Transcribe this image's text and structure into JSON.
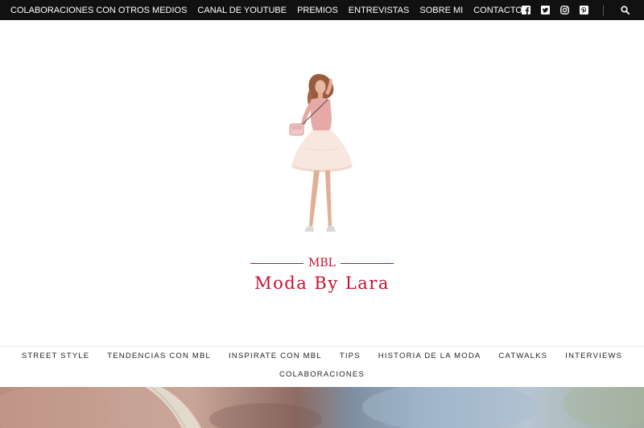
{
  "topbar": {
    "links": [
      "COLABORACIONES CON OTROS MEDIOS",
      "CANAL DE YOUTUBE",
      "PREMIOS",
      "ENTREVISTAS",
      "SOBRE MI",
      "CONTACTO"
    ],
    "social_icons": [
      "facebook-icon",
      "twitter-icon",
      "instagram-icon",
      "pinterest-icon"
    ],
    "search_icon": "search-icon"
  },
  "logo": {
    "mbl": "MBL",
    "brand": "Moda By Lara"
  },
  "main_nav": {
    "row1": [
      "STREET STYLE",
      "TENDENCIAS CON MBL",
      "INSPIRATE CON MBL",
      "TIPS",
      "HISTORIA DE LA MODA",
      "CATWALKS",
      "INTERVIEWS"
    ],
    "row2": [
      "COLABORACIONES"
    ]
  },
  "colors": {
    "topbar_bg": "#111111",
    "brand_red": "#c8102e"
  }
}
